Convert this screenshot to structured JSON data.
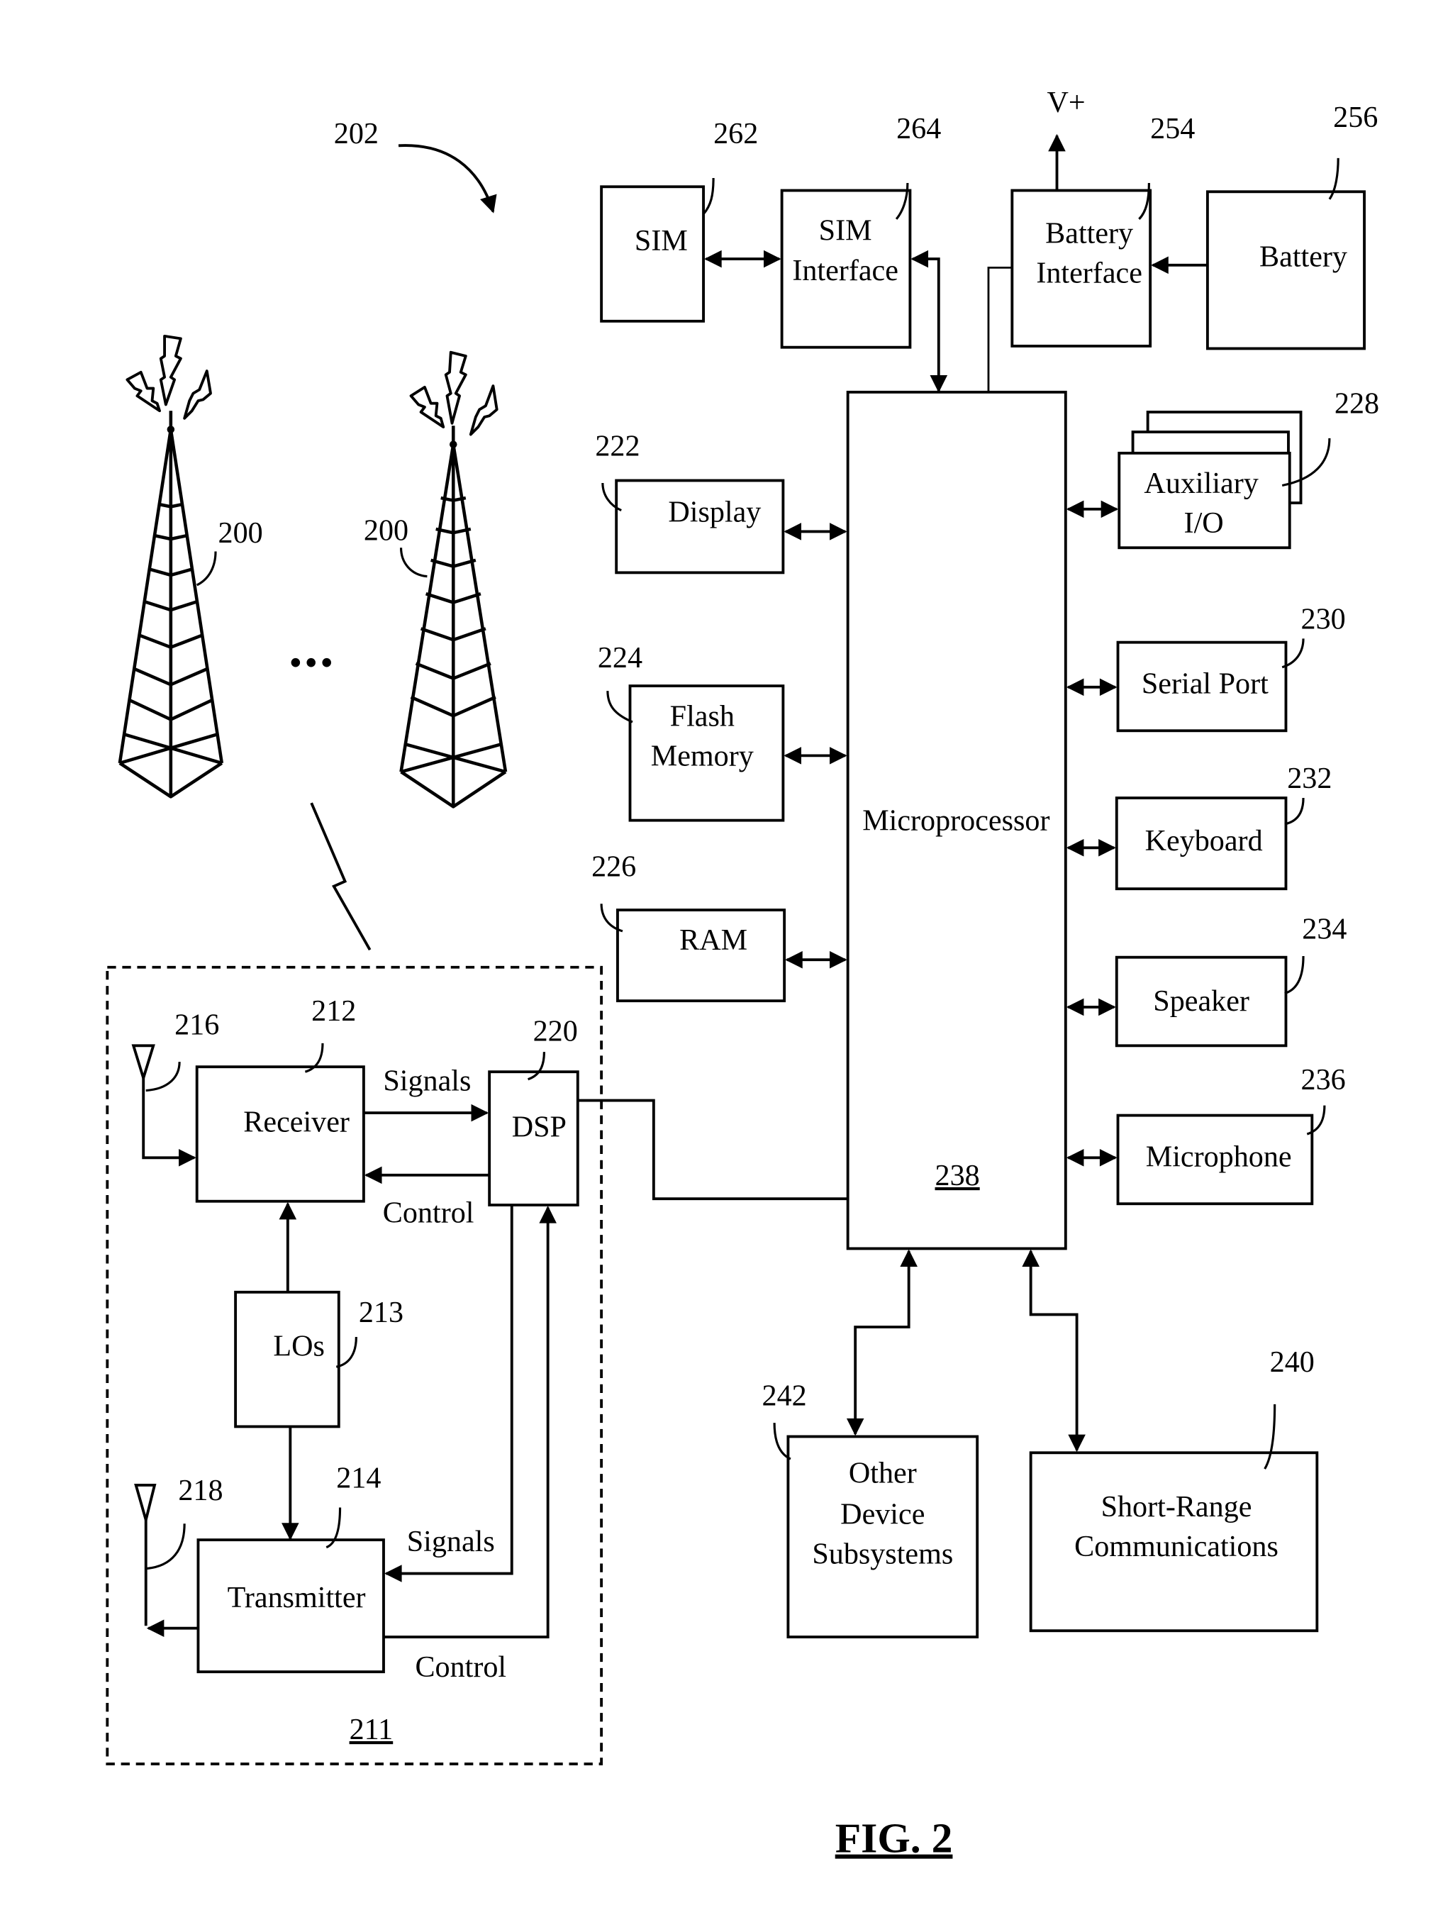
{
  "figure": {
    "title": "FIG. 2",
    "device_ref": "202",
    "tower_ref_left": "200",
    "tower_ref_right": "200",
    "ellipsis": "•••",
    "voltage_label": "V+"
  },
  "blocks": {
    "sim": {
      "label": "SIM",
      "ref": "262"
    },
    "sim_interface": {
      "lines": [
        "SIM",
        "Interface"
      ],
      "ref": "264"
    },
    "battery_interface": {
      "lines": [
        "Battery",
        "Interface"
      ],
      "ref": "254"
    },
    "battery": {
      "label": "Battery",
      "ref": "256"
    },
    "display": {
      "label": "Display",
      "ref": "222"
    },
    "flash_memory": {
      "lines": [
        "Flash",
        "Memory"
      ],
      "ref": "224"
    },
    "ram": {
      "label": "RAM",
      "ref": "226"
    },
    "microprocessor": {
      "label": "Microprocessor",
      "ref": "238"
    },
    "auxiliary_io": {
      "lines": [
        "Auxiliary",
        "I/O"
      ],
      "ref": "228"
    },
    "serial_port": {
      "label": "Serial Port",
      "ref": "230"
    },
    "keyboard": {
      "label": "Keyboard",
      "ref": "232"
    },
    "speaker": {
      "label": "Speaker",
      "ref": "234"
    },
    "microphone": {
      "label": "Microphone",
      "ref": "236"
    },
    "other_device_subsystems": {
      "lines": [
        "Other",
        "Device",
        "Subsystems"
      ],
      "ref": "242"
    },
    "short_range_communications": {
      "lines": [
        "Short-Range",
        "Communications"
      ],
      "ref": "240"
    }
  },
  "communication_subsystem": {
    "ref": "211",
    "receiver": {
      "label": "Receiver",
      "ref": "212"
    },
    "transmitter": {
      "label": "Transmitter",
      "ref": "214"
    },
    "dsp": {
      "label": "DSP",
      "ref": "220"
    },
    "los": {
      "label": "LOs",
      "ref": "213"
    },
    "rx_antenna_ref": "216",
    "tx_antenna_ref": "218",
    "rx_signals_label": "Signals",
    "rx_control_label": "Control",
    "tx_signals_label": "Signals",
    "tx_control_label": "Control"
  }
}
